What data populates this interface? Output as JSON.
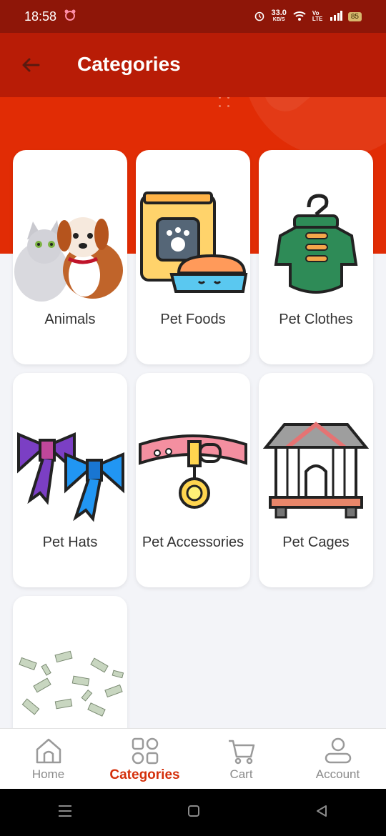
{
  "status_bar": {
    "time": "18:58",
    "net_speed_value": "33.0",
    "net_speed_unit": "KB/S",
    "battery": "85",
    "network_label": "Vo LTE"
  },
  "header": {
    "title": "Categories"
  },
  "categories": [
    {
      "label": "Animals",
      "icon": "cat-dog-icon"
    },
    {
      "label": "Pet Foods",
      "icon": "pet-food-icon"
    },
    {
      "label": "Pet Clothes",
      "icon": "pet-clothes-icon"
    },
    {
      "label": "Pet Hats",
      "icon": "bow-icon"
    },
    {
      "label": "Pet Accessories",
      "icon": "collar-icon"
    },
    {
      "label": "Pet Cages",
      "icon": "cage-icon"
    },
    {
      "label": "",
      "icon": "money-icon"
    }
  ],
  "bottom_nav": {
    "items": [
      {
        "label": "Home",
        "icon": "home-icon"
      },
      {
        "label": "Categories",
        "icon": "grid-icon"
      },
      {
        "label": "Cart",
        "icon": "cart-icon"
      },
      {
        "label": "Account",
        "icon": "account-icon"
      }
    ],
    "active": "Categories",
    "accent": "#d4300b"
  },
  "colors": {
    "header_red": "#e12c05",
    "title_band": "#b81c06",
    "background": "#f3f4f8"
  }
}
